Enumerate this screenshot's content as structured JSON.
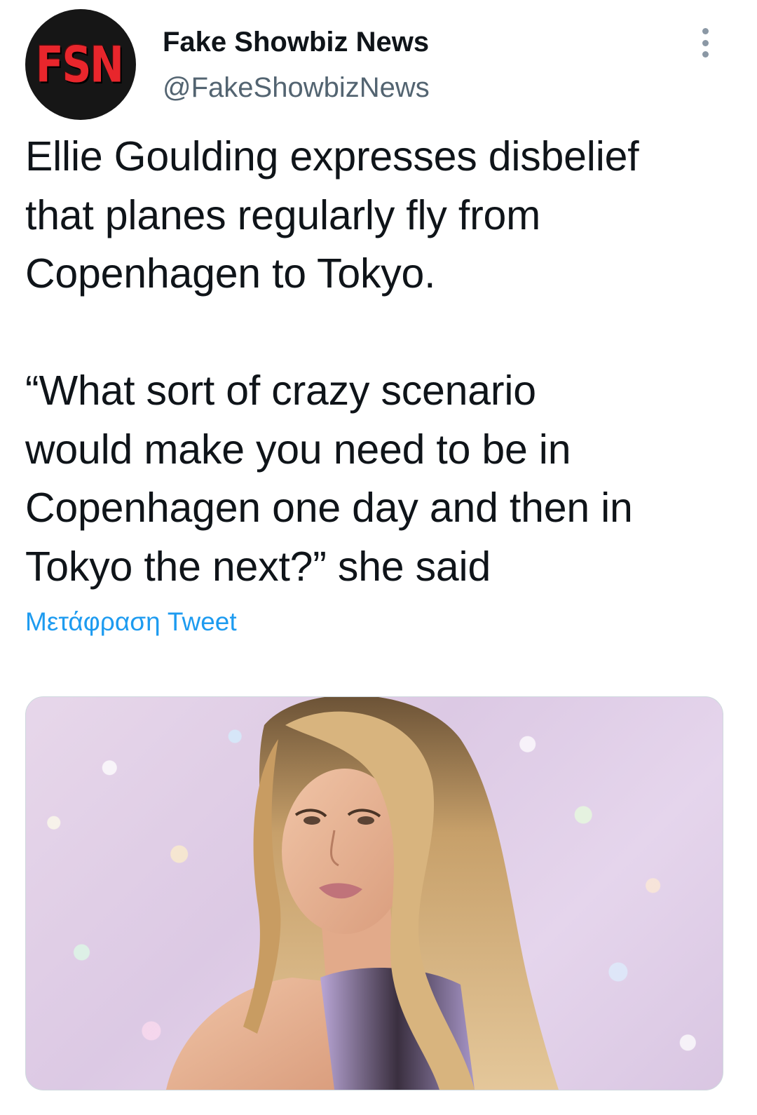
{
  "tweet": {
    "author": {
      "avatar_text": "FSN",
      "display_name": "Fake Showbiz News",
      "handle": "@FakeShowbizNews"
    },
    "more_icon": "more-horizontal-icon",
    "text_paragraphs": [
      "Ellie Goulding expresses disbelief\nthat planes regularly fly from\nCopenhagen to Tokyo.",
      "“What sort of crazy scenario\nwould make you need to be in\nCopenhagen one day and then in\nTokyo the next?” she said"
    ],
    "translate_label": "Μετάφραση Tweet",
    "colors": {
      "text": "#0f1419",
      "secondary_text": "#536471",
      "link": "#1d9bf0",
      "avatar_bg": "#161616",
      "avatar_text": "#e8262c"
    }
  }
}
